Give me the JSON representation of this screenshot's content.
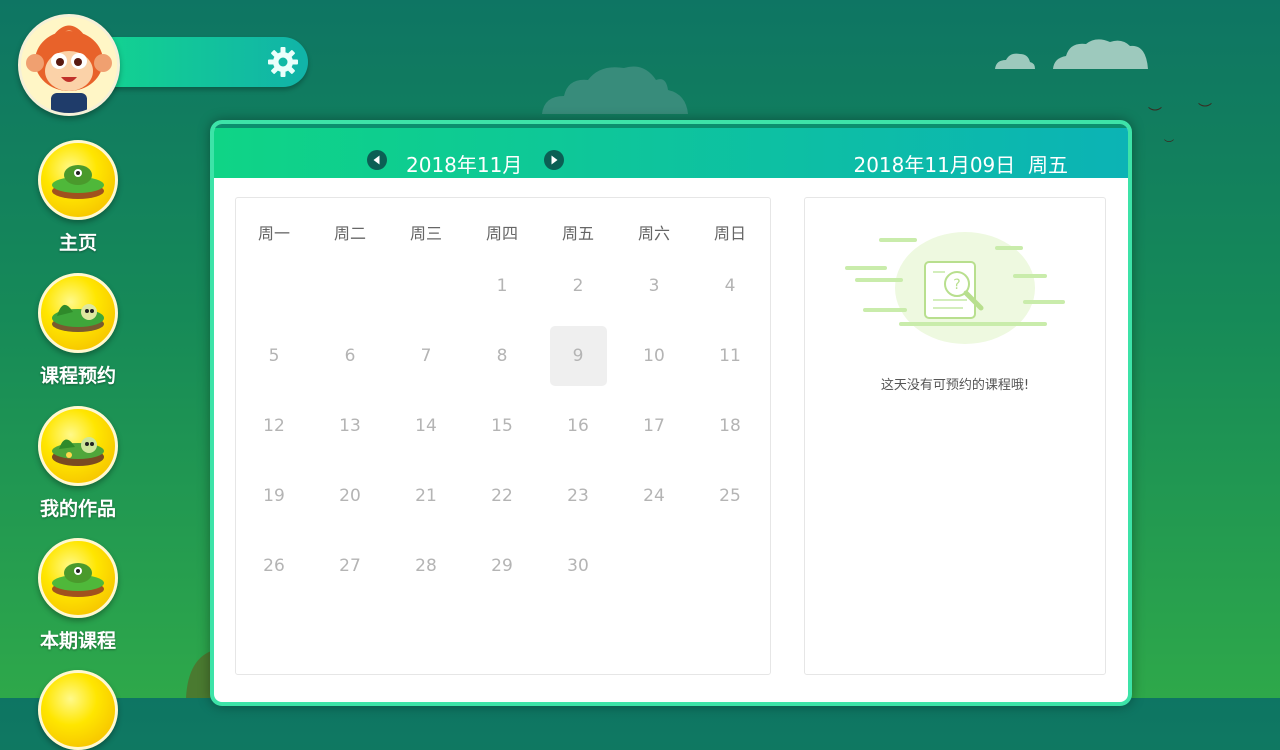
{
  "header": {
    "avatar_icon": "monkey-avatar",
    "settings_icon": "gear-icon"
  },
  "sidebar": {
    "items": [
      {
        "label": "主页",
        "icon": "home-planet-icon"
      },
      {
        "label": "课程预约",
        "icon": "booking-planet-icon"
      },
      {
        "label": "我的作品",
        "icon": "works-planet-icon"
      },
      {
        "label": "本期课程",
        "icon": "current-course-planet-icon"
      }
    ]
  },
  "calendar": {
    "month_label": "2018年11月",
    "selected_date_label": "2018年11月09日  周五",
    "weekdays": [
      "周一",
      "周二",
      "周三",
      "周四",
      "周五",
      "周六",
      "周日"
    ],
    "days": [
      "1",
      "2",
      "3",
      "4",
      "5",
      "6",
      "7",
      "8",
      "9",
      "10",
      "11",
      "12",
      "13",
      "14",
      "15",
      "16",
      "17",
      "18",
      "19",
      "20",
      "21",
      "22",
      "23",
      "24",
      "25",
      "26",
      "27",
      "28",
      "29",
      "30"
    ],
    "first_weekday_index": 3,
    "selected_day": "9"
  },
  "detail": {
    "empty_message": "这天没有可预约的课程哦!"
  },
  "colors": {
    "accent_green": "#13d48f",
    "accent_teal": "#0cb3b5",
    "panel_border": "#3de3a8"
  }
}
